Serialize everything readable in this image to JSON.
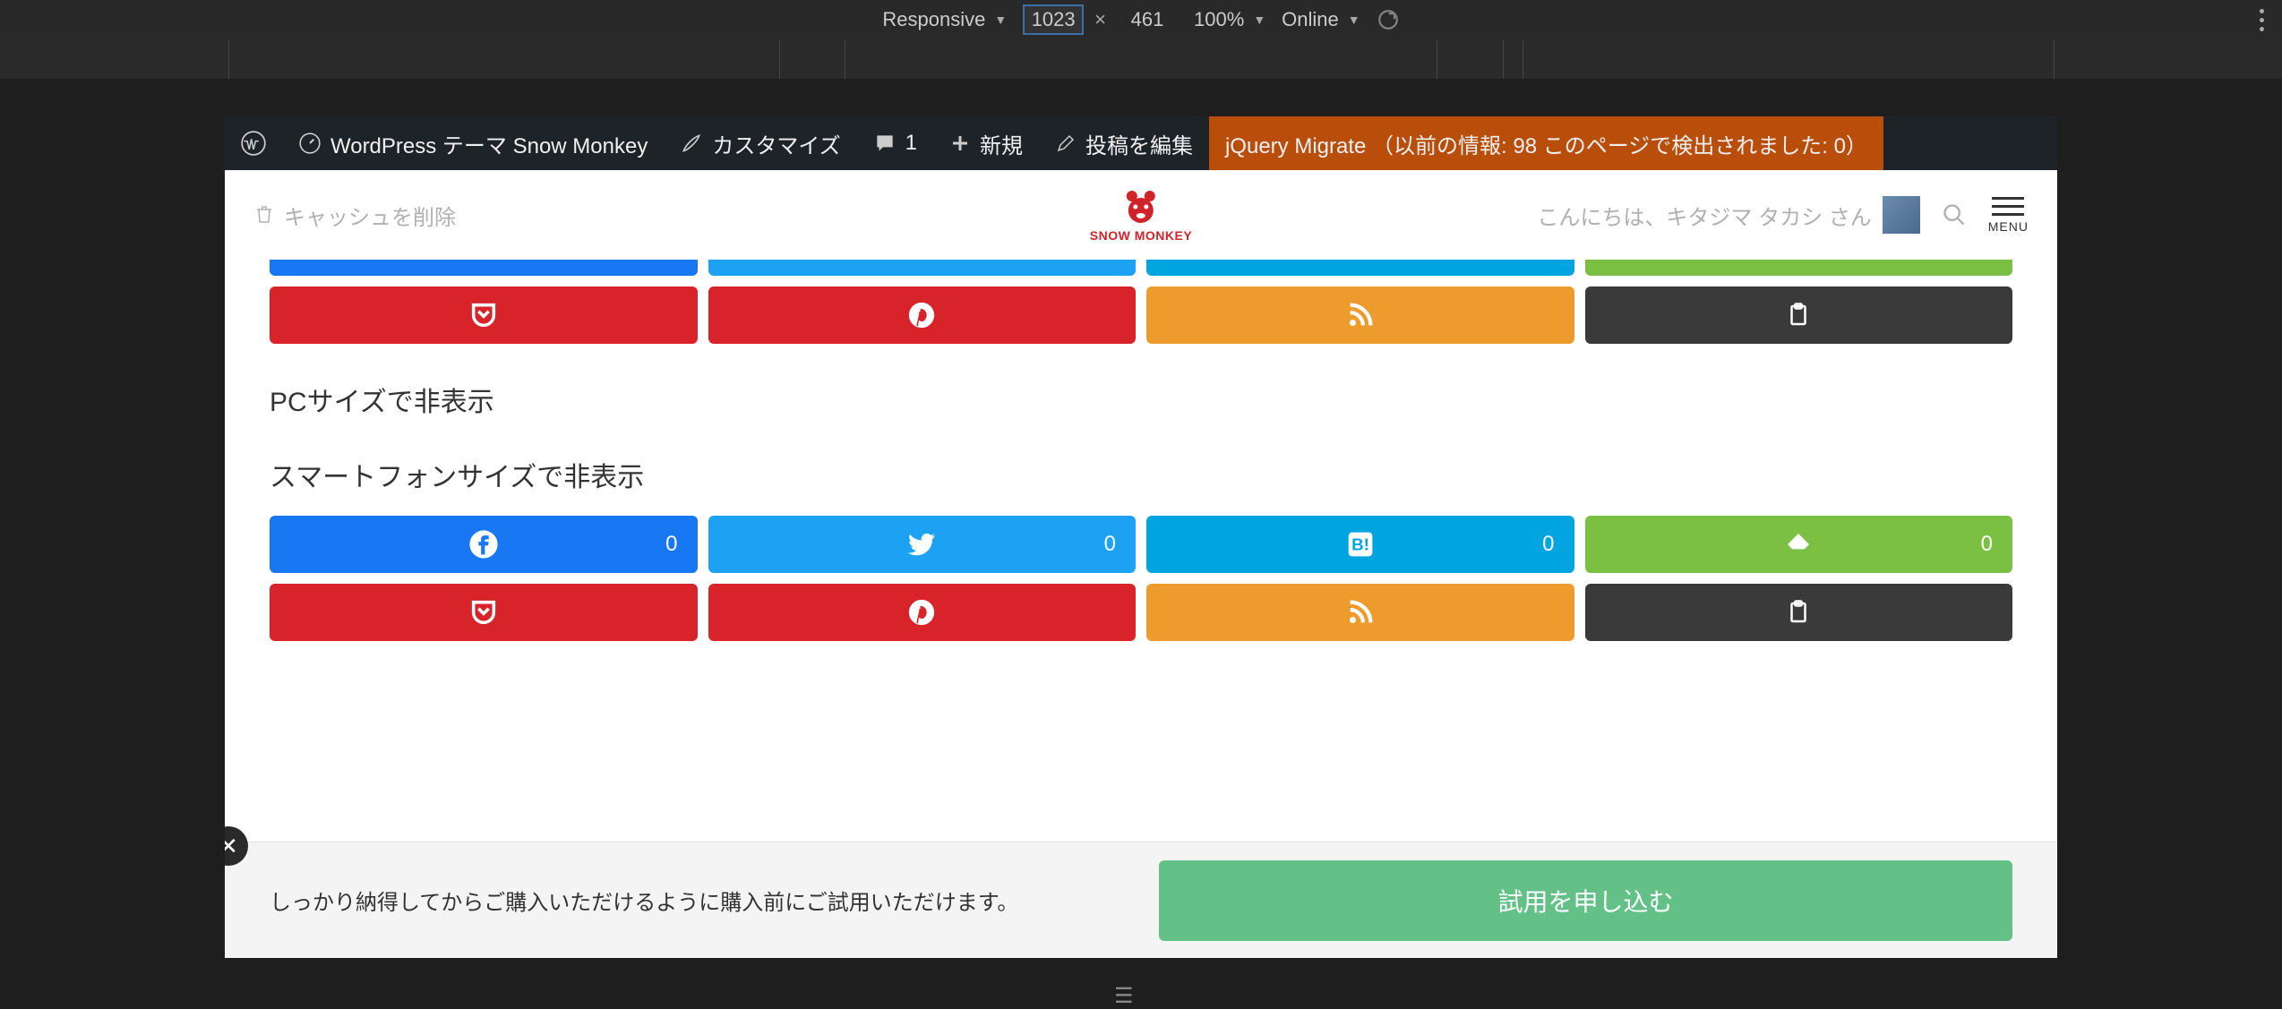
{
  "devtools": {
    "mode": "Responsive",
    "width": "1023",
    "height": "461",
    "zoom": "100%",
    "network": "Online"
  },
  "wp_admin": {
    "site_name": "WordPress テーマ Snow Monkey",
    "customize": "カスタマイズ",
    "comments": "1",
    "new": "新規",
    "edit": "投稿を編集",
    "jquery": "jQuery Migrate （以前の情報: 98 このページで検出されました: 0）"
  },
  "site_header": {
    "cache_delete": "キャッシュを削除",
    "logo_text": "SNOW MONKEY",
    "greeting": "こんにちは、キタジマ タカシ さん",
    "menu": "MENU"
  },
  "sections": {
    "pc_hidden": "PCサイズで非表示",
    "sp_hidden": "スマートフォンサイズで非表示"
  },
  "share": {
    "facebook_count": "0",
    "twitter_count": "0",
    "hatena_count": "0",
    "feedly_count": "0"
  },
  "banner": {
    "text": "しっかり納得してからご購入いただけるように購入前にご試用いただけます。",
    "cta": "試用を申し込む"
  }
}
